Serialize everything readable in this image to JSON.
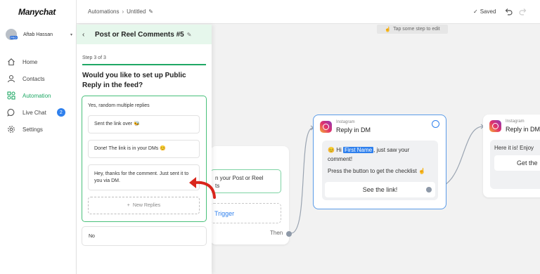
{
  "sidebar": {
    "logo": "Manychat",
    "user_name": "Aftab Hassan",
    "user_badge": "PRO",
    "items": [
      {
        "label": "Home",
        "icon": "home-icon"
      },
      {
        "label": "Contacts",
        "icon": "user-icon"
      },
      {
        "label": "Automation",
        "icon": "automation-icon",
        "active": true
      },
      {
        "label": "Live Chat",
        "icon": "chat-icon",
        "badge": "2"
      },
      {
        "label": "Settings",
        "icon": "gear-icon"
      }
    ]
  },
  "topbar": {
    "breadcrumb_root": "Automations",
    "breadcrumb_current": "Untitled",
    "status": "Saved"
  },
  "canvas": {
    "hint": "Tap some step to edit",
    "trigger_text": "n your Post or Reel\nts",
    "add_trigger": "Trigger",
    "then_label": "Then",
    "dm_node": {
      "source": "Instagram",
      "title": "Reply in DM",
      "greeting": "Hi",
      "first_name_tag": "First Name",
      "message_rest": ", just saw your comment!",
      "cta_text": "Press the button to get the checklist",
      "button": "See the link!"
    },
    "dm_node2": {
      "source": "Instagram",
      "title": "Reply in DM",
      "message": "Here it is! Enjoy",
      "button": "Get the"
    }
  },
  "panel": {
    "title": "Post or Reel Comments #5",
    "step": "Step 3 of 3",
    "question": "Would you like to set up Public Reply in the feed?",
    "option_yes": "Yes, random multiple replies",
    "replies": [
      "Sent the link over 🐝",
      "Done! The link is in your DMs 😊",
      "Hey, thanks for the comment. Just sent it to you via DM."
    ],
    "new_reply": "New Replies",
    "option_no": "No"
  },
  "colors": {
    "accent_green": "#1fa865",
    "accent_blue": "#2f80ed",
    "panel_header": "#e6f7ec"
  }
}
